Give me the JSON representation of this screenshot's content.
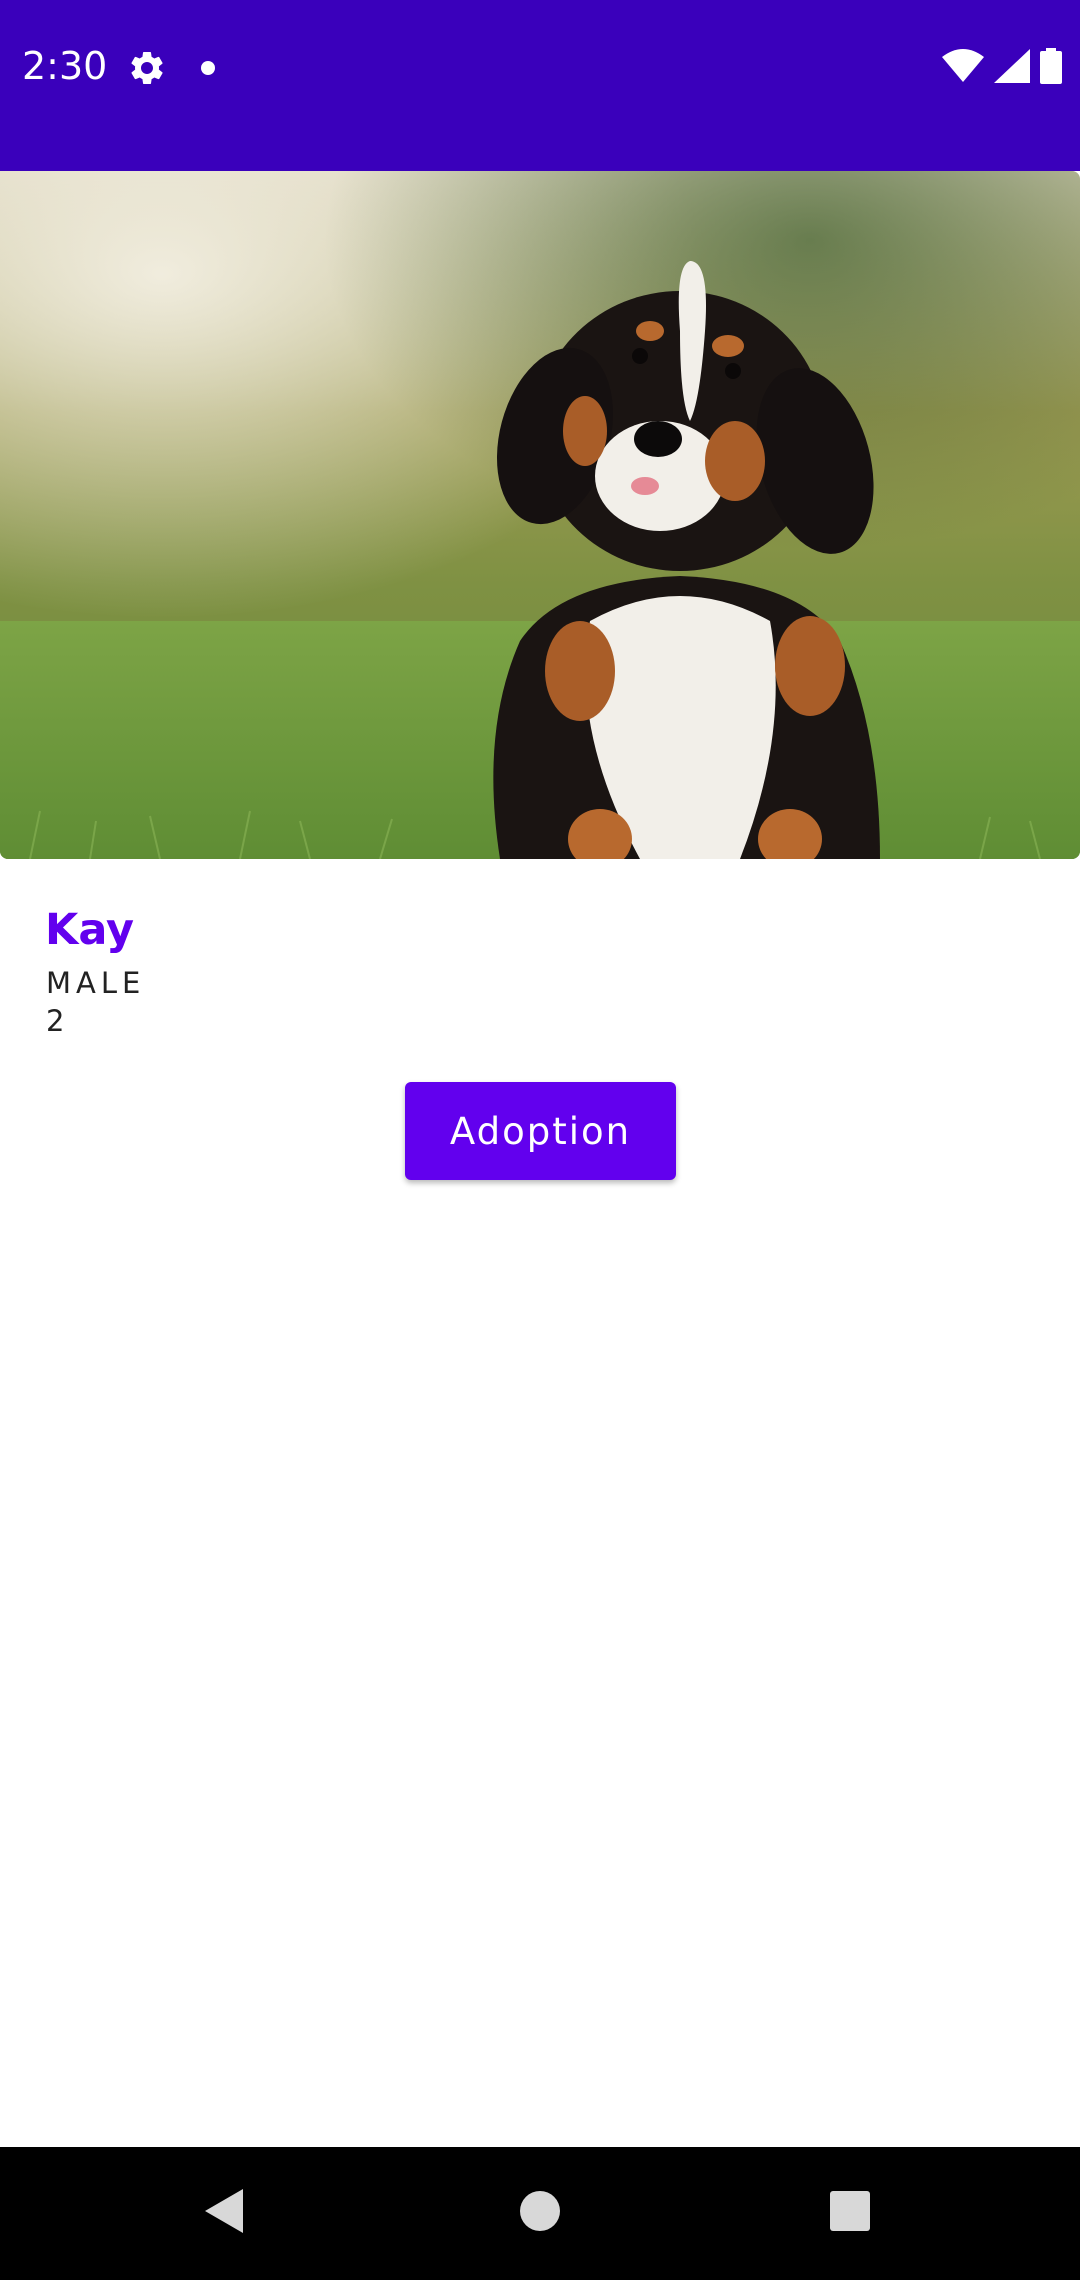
{
  "status_bar": {
    "time": "2:30",
    "icons": [
      "gear-icon",
      "notification-dot-icon",
      "wifi-icon",
      "signal-icon",
      "battery-icon"
    ],
    "background": "#3a00bb"
  },
  "pet": {
    "photo": "bernese-mountain-dog-puppy-on-grass",
    "name": "Kay",
    "sex": "MALE",
    "age": "2"
  },
  "actions": {
    "adopt_label": "Adoption"
  },
  "nav_bar": {
    "icons": [
      "back-icon",
      "home-icon",
      "recents-icon"
    ]
  },
  "colors": {
    "accent": "#6200ee",
    "status_bar": "#3a00bb",
    "text": "#222222"
  }
}
